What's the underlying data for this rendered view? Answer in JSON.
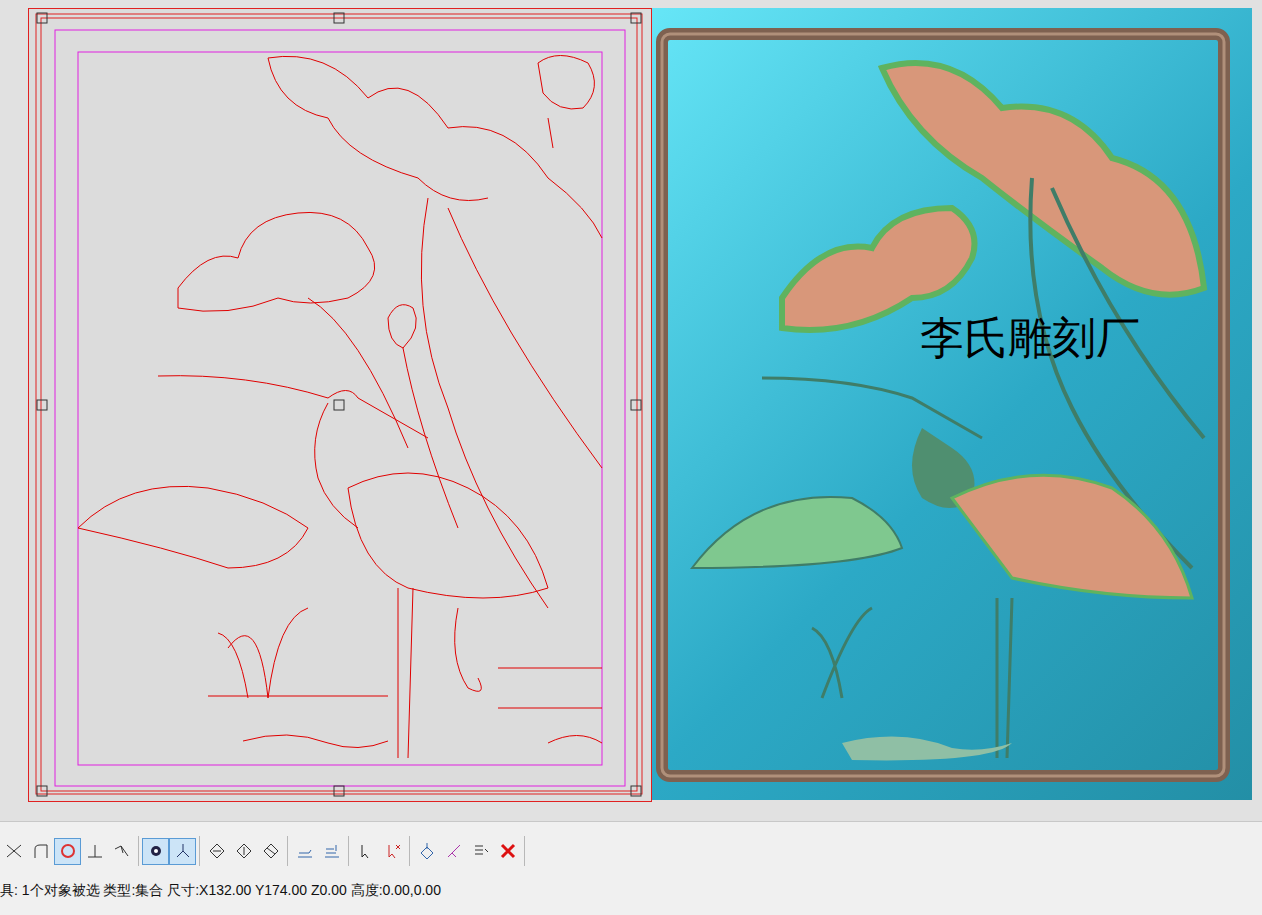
{
  "canvas": {
    "watermark": "李氏雕刻厂"
  },
  "toolbar": {
    "groups": [
      [
        {
          "selected": false
        },
        {
          "selected": false
        },
        {
          "selected": true
        },
        {
          "selected": false
        },
        {
          "selected": false
        }
      ],
      [
        {
          "selected": true
        },
        {
          "selected": true
        }
      ],
      [
        {
          "selected": false
        },
        {
          "selected": false
        },
        {
          "selected": false
        }
      ],
      [
        {
          "selected": false
        },
        {
          "selected": false
        }
      ],
      [
        {
          "selected": false
        },
        {
          "selected": false
        }
      ],
      [
        {
          "selected": false
        },
        {
          "selected": false
        },
        {
          "selected": false
        },
        {
          "selected": false
        }
      ]
    ]
  },
  "status_bar": {
    "text": "具: 1个对象被选 类型:集合 尺寸:X132.00 Y174.00 Z0.00 高度:0.00,0.00"
  }
}
